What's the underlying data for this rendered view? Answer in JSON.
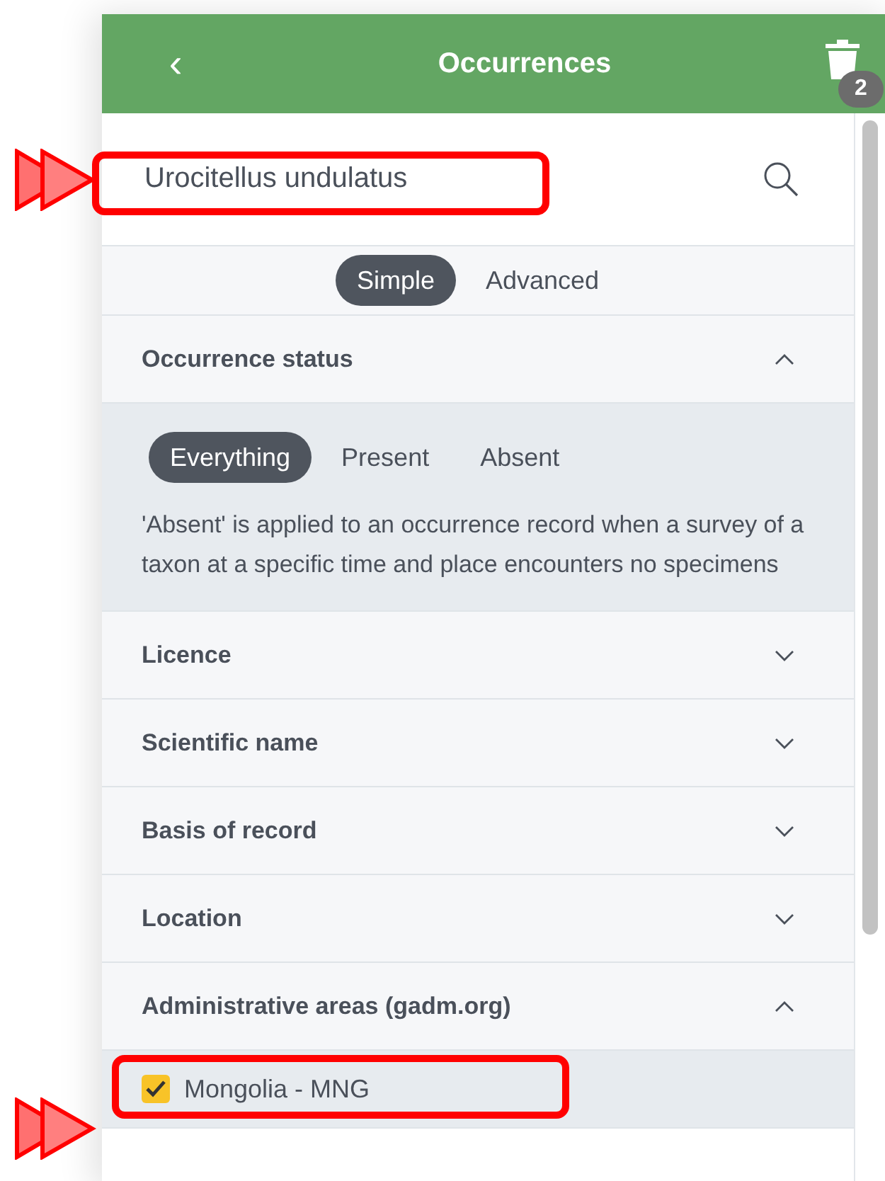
{
  "header": {
    "back": "‹",
    "title": "Occurrences",
    "badge": "2"
  },
  "search": {
    "value": "Urocitellus undulatus",
    "highlighted": true
  },
  "modes": [
    {
      "label": "Simple",
      "selected": true
    },
    {
      "label": "Advanced",
      "selected": false
    }
  ],
  "sections": [
    {
      "title": "Occurrence status",
      "expanded": true,
      "kind": "options",
      "options": [
        {
          "label": "Everything",
          "selected": true
        },
        {
          "label": "Present",
          "selected": false
        },
        {
          "label": "Absent",
          "selected": false
        }
      ],
      "note": "'Absent' is applied to an occurrence record when a survey of a taxon at a specific time and place encounters no specimens"
    },
    {
      "title": "Licence",
      "expanded": false
    },
    {
      "title": "Scientific name",
      "expanded": false
    },
    {
      "title": "Basis of record",
      "expanded": false
    },
    {
      "title": "Location",
      "expanded": false
    },
    {
      "title": "Administrative areas (gadm.org)",
      "expanded": true,
      "kind": "checklist",
      "items": [
        {
          "label": "Mongolia - MNG",
          "checked": true,
          "highlighted": true
        }
      ]
    }
  ]
}
